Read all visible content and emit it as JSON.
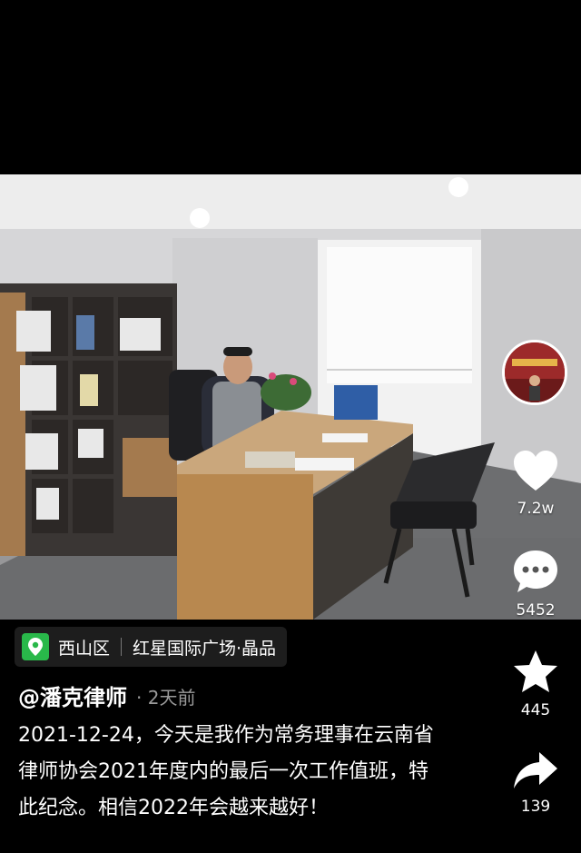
{
  "rail": {
    "like_count": "7.2w",
    "comment_count": "5452",
    "favorite_count": "445",
    "share_count": "139"
  },
  "location": {
    "district": "西山区",
    "place": "红星国际广场·晶品"
  },
  "post": {
    "author": "@潘克律师",
    "time": "· 2天前",
    "caption": "2021-12-24，今天是我作为常务理事在云南省律师协会2021年度内的最后一次工作值班，特此纪念。相信2022年会越来越好！"
  },
  "icons": [
    "heart-icon",
    "comment-icon",
    "star-icon",
    "share-icon",
    "location-pin-icon"
  ],
  "colors": {
    "background": "#000000",
    "location_pin": "#29b84a",
    "secondary_text": "#9a9a9a"
  }
}
